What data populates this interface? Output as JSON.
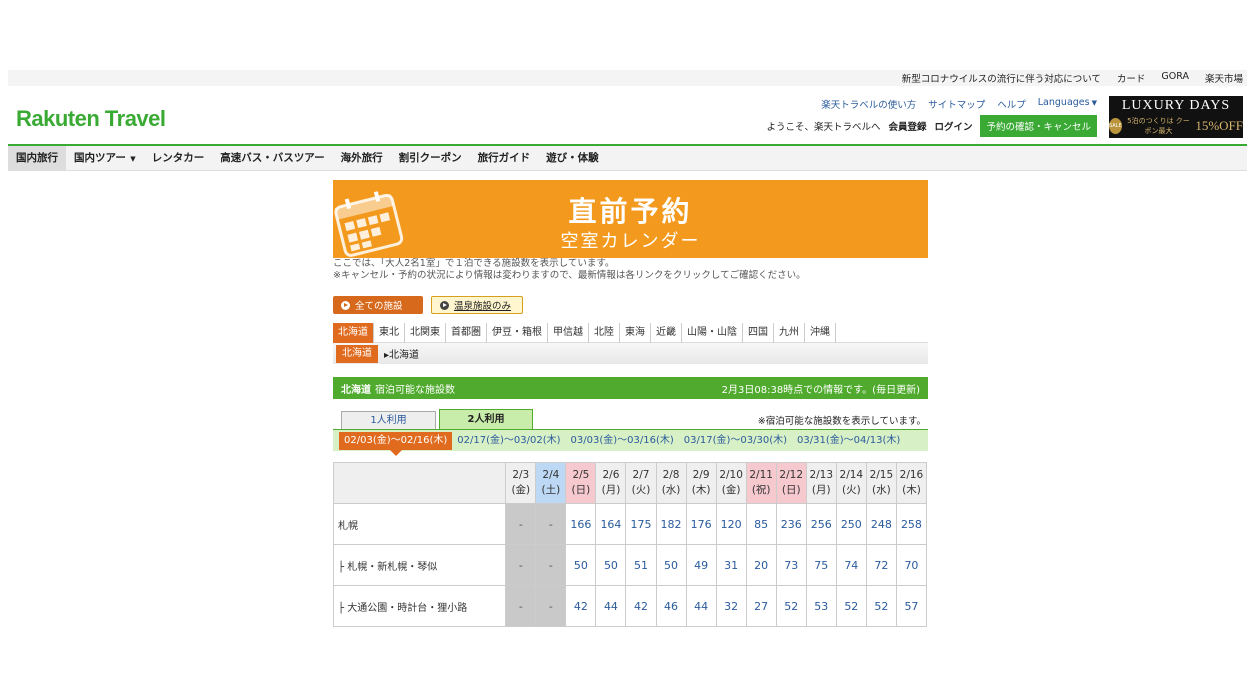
{
  "topbar": {
    "links": [
      "新型コロナウイルスの流行に伴う対応について",
      "カード",
      "GORA",
      "楽天市場"
    ]
  },
  "header": {
    "logo": "Rakuten Travel",
    "help_links": [
      "楽天トラベルの使い方",
      "サイトマップ",
      "ヘルプ",
      "Languages"
    ],
    "welcome": "ようこそ、楽天トラベルへ",
    "register": "会員登録",
    "login": "ログイン",
    "reserve_btn": "予約の確認・キャンセル",
    "luxury_title": "LUXURY DAYS",
    "luxury_sale": "SALE",
    "luxury_coupon": "5泊のつくりは クーポン最大",
    "luxury_off": "15%OFF"
  },
  "gnav": [
    "国内旅行",
    "国内ツアー",
    "レンタカー",
    "高速バス・バスツアー",
    "海外旅行",
    "割引クーポン",
    "旅行ガイド",
    "遊び・体験"
  ],
  "banner": {
    "title": "直前予約",
    "subtitle": "空室カレンダー"
  },
  "note": {
    "line1": "ここでは、「大人2名1室」で１泊できる施設数を表示しています。",
    "line2": "※キャンセル・予約の状況により情報は変わりますので、最新情報は各リンクをクリックしてご確認ください。"
  },
  "filters": {
    "all": "全ての施設",
    "onsen": "温泉施設のみ"
  },
  "regions": [
    "北海道",
    "東北",
    "北関東",
    "首都圏",
    "伊豆・箱根",
    "甲信越",
    "北陸",
    "東海",
    "近畿",
    "山陽・山陰",
    "四国",
    "九州",
    "沖縄"
  ],
  "subregion": {
    "tag": "北海道",
    "selected": "北海道"
  },
  "info_bar": {
    "region": "北海道",
    "label": "宿泊可能な施設数",
    "updated": "2月3日08:38時点での情報です。(毎日更新)"
  },
  "people": {
    "one": "1人利用",
    "two": "2人利用",
    "note": "※宿泊可能な施設数を表示しています。"
  },
  "date_ranges": [
    "02/03(金)〜02/16(木)",
    "02/17(金)〜03/02(木)",
    "03/03(金)〜03/16(木)",
    "03/17(金)〜03/30(木)",
    "03/31(金)〜04/13(木)"
  ],
  "table": {
    "dates": [
      {
        "d": "2/3",
        "w": "(金)",
        "type": ""
      },
      {
        "d": "2/4",
        "w": "(土)",
        "type": "sat"
      },
      {
        "d": "2/5",
        "w": "(日)",
        "type": "hol"
      },
      {
        "d": "2/6",
        "w": "(月)",
        "type": ""
      },
      {
        "d": "2/7",
        "w": "(火)",
        "type": ""
      },
      {
        "d": "2/8",
        "w": "(水)",
        "type": ""
      },
      {
        "d": "2/9",
        "w": "(木)",
        "type": ""
      },
      {
        "d": "2/10",
        "w": "(金)",
        "type": ""
      },
      {
        "d": "2/11",
        "w": "(祝)",
        "type": "hol"
      },
      {
        "d": "2/12",
        "w": "(日)",
        "type": "hol"
      },
      {
        "d": "2/13",
        "w": "(月)",
        "type": ""
      },
      {
        "d": "2/14",
        "w": "(火)",
        "type": ""
      },
      {
        "d": "2/15",
        "w": "(水)",
        "type": ""
      },
      {
        "d": "2/16",
        "w": "(木)",
        "type": ""
      }
    ],
    "rows": [
      {
        "area": "札幌",
        "values": [
          "-",
          "-",
          "166",
          "164",
          "175",
          "182",
          "176",
          "120",
          "85",
          "236",
          "256",
          "250",
          "248",
          "258"
        ]
      },
      {
        "area": "├ 札幌・新札幌・琴似",
        "values": [
          "-",
          "-",
          "50",
          "50",
          "51",
          "50",
          "49",
          "31",
          "20",
          "73",
          "75",
          "74",
          "72",
          "70"
        ]
      },
      {
        "area": "├ 大通公園・時計台・狸小路",
        "values": [
          "-",
          "-",
          "42",
          "44",
          "42",
          "46",
          "44",
          "32",
          "27",
          "52",
          "53",
          "52",
          "52",
          "57"
        ]
      }
    ]
  }
}
